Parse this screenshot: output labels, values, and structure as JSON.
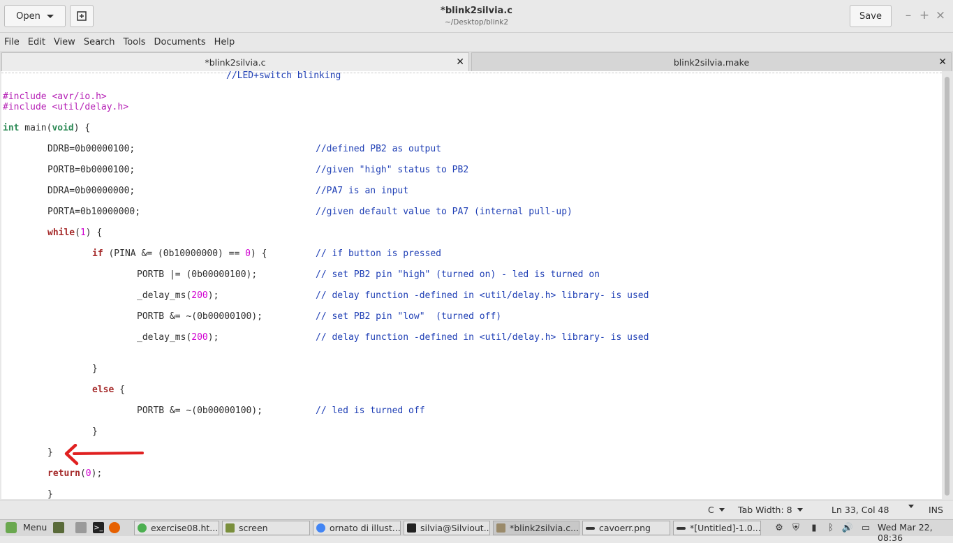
{
  "window": {
    "title": "*blink2silvia.c",
    "subtitle": "~/Desktop/blink2",
    "open_label": "Open",
    "save_label": "Save",
    "minimize": "–",
    "maximize": "+",
    "close": "×"
  },
  "menu": [
    "File",
    "Edit",
    "View",
    "Search",
    "Tools",
    "Documents",
    "Help"
  ],
  "tabs": [
    {
      "label": "*blink2silvia.c",
      "active": true
    },
    {
      "label": "blink2silvia.make",
      "active": false
    }
  ],
  "code": {
    "line0": "//LED+switch blinking",
    "inc1_dir": "#include ",
    "inc1_file": "<avr/io.h>",
    "inc2_dir": "#include ",
    "inc2_file": "<util/delay.h>",
    "main_int": "int",
    "main_mid": " main(",
    "main_void": "void",
    "main_end": ") {",
    "ddrb": "DDRB=0b00000100;",
    "ddrb_c": "//defined PB2 as output",
    "portb": "PORTB=0b0000100;",
    "portb_c": "//given \"high\" status to PB2",
    "ddra": "DDRA=0b00000000;",
    "ddra_c": "//PA7 is an input",
    "porta": "PORTA=0b10000000;",
    "porta_c": "//given default value to PA7 (internal pull-up)",
    "while_kw": "while",
    "while_open": "(",
    "while_num": "1",
    "while_end": ") {",
    "if_kw": "if",
    "if_mid": " (PINA &= (0b10000000) == ",
    "if_num": "0",
    "if_end": ") {",
    "if_c": "// if button is pressed",
    "set_on": "PORTB |= (0b00000100);",
    "set_on_c": "// set PB2 pin \"high\" (turned on) - led is turned on",
    "delay_fn": "_delay_ms(",
    "delay_num": "200",
    "delay_end": ");",
    "delay_c": "// delay function -defined in <util/delay.h> library- is used",
    "set_off": "PORTB &= ~(0b00000100);",
    "set_off_c": "// set PB2 pin \"low\"  (turned off)",
    "close_if": "}",
    "else_kw": "else",
    "else_end": " {",
    "led_off": "PORTB &= ~(0b00000100);",
    "led_off_c": "// led is turned off",
    "close_else": "}",
    "close_while": "}",
    "return_kw": "return",
    "return_open": "(",
    "return_num": "0",
    "return_end": ");",
    "close_main": "}"
  },
  "status": {
    "language": "C",
    "tab_width": "Tab Width: 8",
    "position": "Ln 33, Col 48",
    "mode": "INS"
  },
  "taskbar": {
    "menu_label": "Menu",
    "tasks": [
      {
        "label": "exercise08.ht...",
        "icon_color": "#4caf50"
      },
      {
        "label": "screen",
        "icon_color": "#7a8f3c"
      },
      {
        "label": "ornato di illust...",
        "icon_color": "#4285f4"
      },
      {
        "label": "silvia@Silviout...",
        "icon_color": "#222222"
      },
      {
        "label": "*blink2silvia.c...",
        "icon_color": "#9a8a6a"
      },
      {
        "label": "cavoerr.png",
        "icon_color": "#333333"
      },
      {
        "label": "*[Untitled]-1.0...",
        "icon_color": "#333333"
      }
    ],
    "clock": "Wed Mar 22, 08:36"
  },
  "colors": {
    "keyword": "#a52a2a",
    "type": "#2e8b57",
    "preprocessor": "#b51fb5",
    "number": "#d100d1",
    "comment": "#1f3fb5",
    "annotation_arrow": "#e02020"
  }
}
